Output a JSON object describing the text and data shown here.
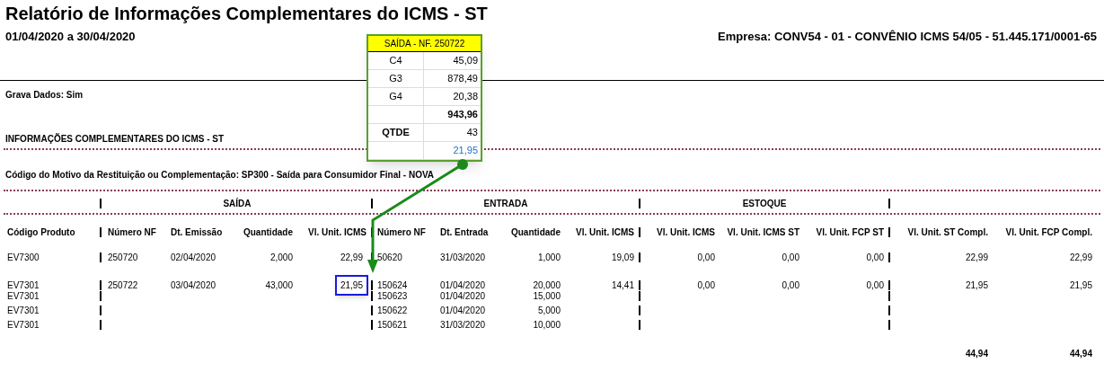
{
  "header": {
    "title": "Relatório de Informações Complementares do ICMS - ST",
    "period": "01/04/2020 a 30/04/2020",
    "company": "Empresa: CONV54 - 01 - CONVÊNIO ICMS 54/05 - 51.445.171/0001-65"
  },
  "grava_dados": "Grava Dados: Sim",
  "section_title": "INFORMAÇÕES COMPLEMENTARES DO ICMS - ST",
  "motivo": "Código do Motivo da Restituição ou Complementação: SP300 - Saída para Consumidor Final - NOVA",
  "table": {
    "groups": [
      "SAÍDA",
      "ENTRADA",
      "ESTOQUE"
    ],
    "columns": [
      "Código Produto",
      "Número NF",
      "Dt. Emissão",
      "Quantidade",
      "Vl. Unit. ICMS",
      "Número NF",
      "Dt. Entrada",
      "Quantidade",
      "Vl. Unit. ICMS",
      "Vl. Unit. ICMS",
      "Vl. Unit. ICMS ST",
      "Vl. Unit. FCP ST",
      "Vl. Unit. ST Compl.",
      "Vl. Unit. FCP Compl."
    ],
    "rows": [
      {
        "icms": {
          "value": "22,99",
          "highlighted": false
        },
        "cells": [
          "EV7300",
          "250720",
          "02/04/2020",
          "2,000",
          null,
          "50620",
          "31/03/2020",
          "1,000",
          "19,09",
          "0,00",
          "0,00",
          "0,00",
          "22,99",
          "22,99"
        ]
      },
      {
        "icms": {
          "value": "21,95",
          "highlighted": true
        },
        "cells": [
          "EV7301",
          "250722",
          "03/04/2020",
          "43,000",
          null,
          "150624",
          "01/04/2020",
          "20,000",
          "14,41",
          "0,00",
          "0,00",
          "0,00",
          "21,95",
          "21,95"
        ]
      },
      {
        "cells": [
          "EV7301",
          null,
          null,
          null,
          null,
          "150623",
          "01/04/2020",
          "15,000",
          null,
          null,
          null,
          null,
          null,
          null
        ]
      },
      {
        "cells": [
          "EV7301",
          null,
          null,
          null,
          null,
          "150622",
          "01/04/2020",
          "5,000",
          null,
          null,
          null,
          null,
          null,
          null
        ]
      },
      {
        "cells": [
          "EV7301",
          null,
          null,
          null,
          null,
          "150621",
          "31/03/2020",
          "10,000",
          null,
          null,
          null,
          null,
          null,
          null
        ]
      }
    ],
    "totals": [
      "44,94",
      "44,94"
    ]
  },
  "callout": {
    "title": "SAÍDA - NF. 250722",
    "rows": [
      {
        "kind": "item",
        "label": "C4",
        "value": "45,09"
      },
      {
        "kind": "item",
        "label": "G3",
        "value": "878,49"
      },
      {
        "kind": "item",
        "label": "G4",
        "value": "20,38"
      },
      {
        "kind": "total",
        "label": null,
        "value": "943,96"
      },
      {
        "kind": "qty",
        "label": "QTDE",
        "value": "43"
      },
      {
        "kind": "result",
        "label": null,
        "value": "21,95"
      }
    ]
  }
}
